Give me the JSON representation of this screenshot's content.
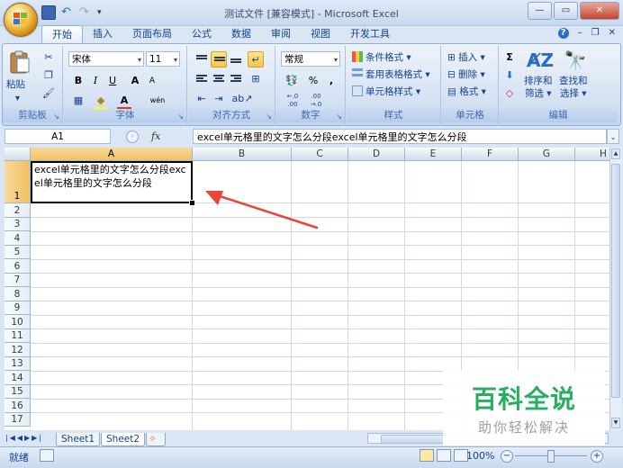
{
  "window": {
    "title": "测试文件 [兼容模式] - Microsoft Excel",
    "controls": {
      "minimize": "—",
      "maximize": "▭",
      "close": "✕"
    }
  },
  "quick_access": {
    "icons": [
      "save-icon",
      "undo-icon",
      "redo-icon",
      "customize-icon"
    ]
  },
  "ribbon_tabs": [
    "开始",
    "插入",
    "页面布局",
    "公式",
    "数据",
    "审阅",
    "视图",
    "开发工具"
  ],
  "ribbon_right": {
    "help": "?",
    "minimize": "–",
    "restore": "❐",
    "close": "✕"
  },
  "ribbon": {
    "clipboard": {
      "label": "剪贴板",
      "paste": "粘贴"
    },
    "font": {
      "label": "字体",
      "font_name": "宋体",
      "font_size": "11",
      "bold": "B",
      "italic": "I",
      "underline": "U",
      "grow": "A",
      "shrink": "A",
      "font_color": "A",
      "phonetic": "wén"
    },
    "alignment": {
      "label": "对齐方式"
    },
    "number": {
      "label": "数字",
      "format": "常规",
      "percent": "%",
      "comma": ",",
      "inc_decimal": "←.0 .00",
      "dec_decimal": ".00 →.0"
    },
    "styles": {
      "label": "样式",
      "conditional": "条件格式",
      "table": "套用表格格式",
      "cell_style": "单元格样式"
    },
    "cells": {
      "label": "单元格",
      "insert": "插入",
      "delete": "删除",
      "format": "格式"
    },
    "editing": {
      "label": "编辑",
      "sigma": "Σ",
      "sort": "排序和",
      "sort2": "筛选",
      "find": "查找和",
      "find2": "选择"
    }
  },
  "formula_bar": {
    "name_box": "A1",
    "fx": "fx",
    "content": "excel单元格里的文字怎么分段excel单元格里的文字怎么分段"
  },
  "grid": {
    "columns": [
      "A",
      "B",
      "C",
      "D",
      "E",
      "F",
      "G",
      "H"
    ],
    "rows": [
      "1",
      "2",
      "3",
      "4",
      "5",
      "6",
      "7",
      "8",
      "9",
      "10",
      "11",
      "12",
      "13",
      "14",
      "15",
      "16",
      "17"
    ],
    "cell_a1": "excel单元格里的文字怎么分段excel单元格里的文字怎么分段",
    "selected_column": "A",
    "selected_row": "1"
  },
  "sheets": {
    "tabs": [
      "Sheet1",
      "Sheet2"
    ],
    "active": "Sheet2"
  },
  "status": {
    "ready": "就绪",
    "zoom": "100%"
  },
  "watermark": {
    "title": "百科全说",
    "subtitle": "助你轻松解决"
  },
  "colors": {
    "accent": "#15428b",
    "arrow": "#e8453c",
    "selection_header": "#f1c15f",
    "watermark_green": "#27ae60"
  }
}
